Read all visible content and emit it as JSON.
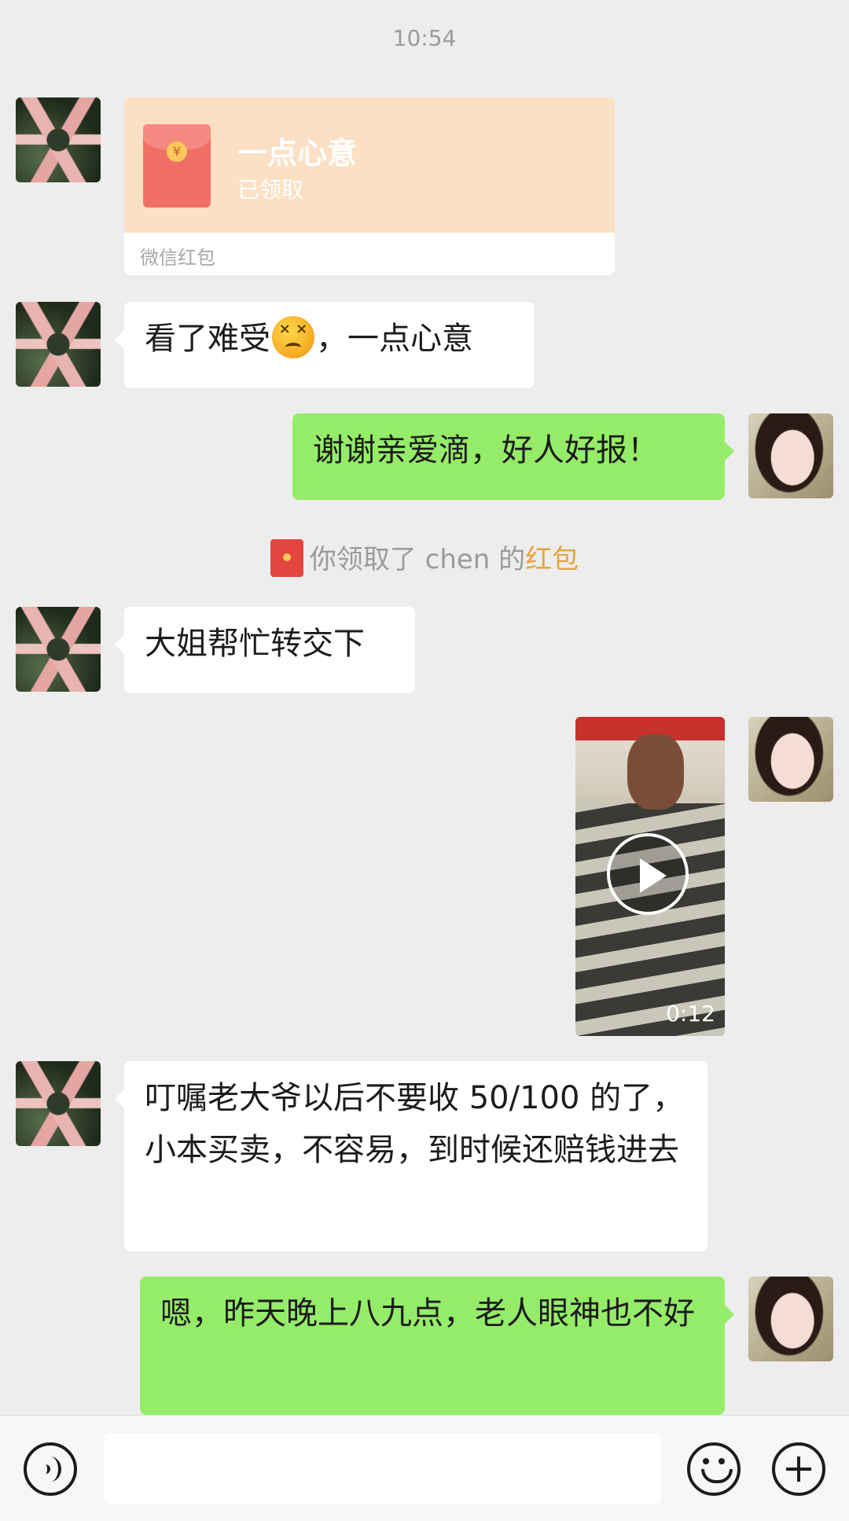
{
  "time_divider": "10:54",
  "contacts": {
    "left_avatar": "avatar-hands-star",
    "right_avatar": "avatar-woman"
  },
  "messages": [
    {
      "type": "red_packet",
      "side": "left",
      "title": "一点心意",
      "status": "已领取",
      "footer": "微信红包"
    },
    {
      "type": "text",
      "side": "left",
      "text_before": "看了难受",
      "emoji": "persevering-face-emoji",
      "text_after": "，一点心意"
    },
    {
      "type": "text",
      "side": "right",
      "text": "谢谢亲爱滴，好人好报！"
    },
    {
      "type": "system",
      "text": "你领取了 chen 的",
      "link": "红包"
    },
    {
      "type": "text",
      "side": "left",
      "text": "大姐帮忙转交下"
    },
    {
      "type": "video",
      "side": "right",
      "duration": "0:12"
    },
    {
      "type": "text",
      "side": "left",
      "text": "叮嘱老大爷以后不要收 50/100 的了，小本买卖，不容易，到时候还赔钱进去"
    },
    {
      "type": "text",
      "side": "right",
      "text": "嗯，昨天晚上八九点，老人眼神也不好"
    }
  ],
  "input_bar": {
    "voice_icon": "voice-icon",
    "input_value": "",
    "emoji_icon": "smiley-icon",
    "more_icon": "plus-icon"
  },
  "colors": {
    "background": "#ededed",
    "outgoing_bubble": "#95ec69",
    "incoming_bubble": "#ffffff",
    "red_packet_bg": "#fbe0c4",
    "red_packet_link": "#e7a23f"
  }
}
